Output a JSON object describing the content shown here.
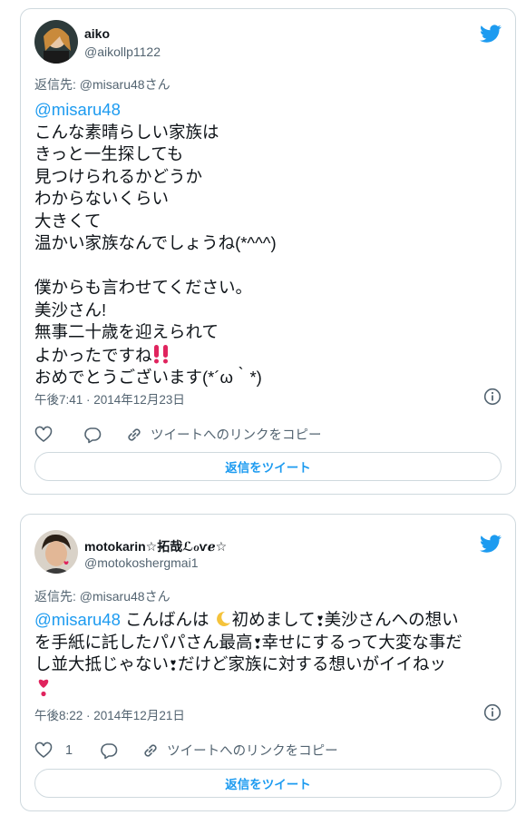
{
  "tweets": [
    {
      "name": "aiko",
      "handle": "@aikollp1122",
      "reply_to": "返信先: @misaru48さん",
      "mention": "@misaru48",
      "lines": [
        "こんな素晴らしい家族は",
        "きっと一生探しても",
        "見つけられるかどうか",
        "わからないくらい",
        "大きくて",
        "温かい家族なんでしょうね(*^^^)",
        "",
        "僕からも言わせてください。",
        "美沙さん!",
        "無事二十歳を迎えられて",
        "よかったですね",
        "おめでとうございます(*´ω｀*)"
      ],
      "timestamp": "午後7:41 · 2014年12月23日",
      "copy_link_label": "ツイートへのリンクをコピー",
      "reply_button_label": "返信をツイート"
    },
    {
      "name": "motokarin☆拓哉ℒℴѵℯ☆",
      "handle": "@motokoshergmai1",
      "reply_to": "返信先: @misaru48さん",
      "mention": "@misaru48",
      "text_a": " こんばんは ",
      "text_b": "初めまして",
      "text_c": "美沙さんへの想い",
      "line2a": "を手紙に託したパパさん最高",
      "line2b": "幸せにするって大変な事だ",
      "line3a": "し並大抵じゃない",
      "line3b": "だけど家族に対する想いがイイねッ",
      "like_count": "1",
      "timestamp": "午後8:22 · 2014年12月21日",
      "copy_link_label": "ツイートへのリンクをコピー",
      "reply_button_label": "返信をツイート"
    }
  ],
  "colors": {
    "accent": "#1d9bf0",
    "border": "#cfd9de",
    "muted": "#536471",
    "heart": "#e0245e"
  },
  "icons": [
    "twitter-bird-icon",
    "heart-icon",
    "reply-icon",
    "link-icon",
    "info-icon",
    "double-exclamation-emoji",
    "crescent-moon-emoji",
    "heart-exclamation-emoji"
  ]
}
